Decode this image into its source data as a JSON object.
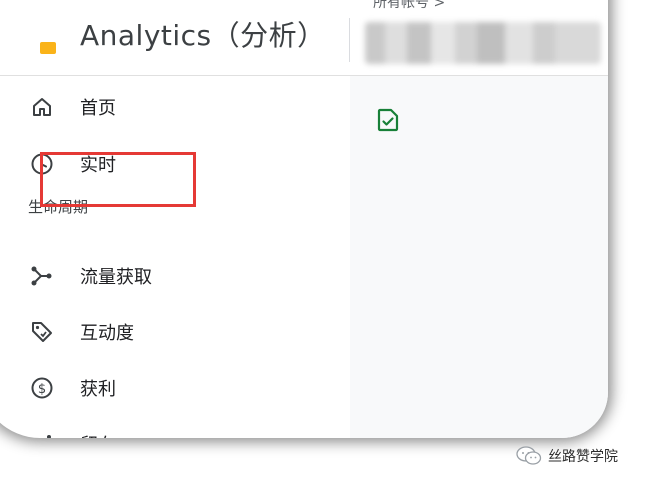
{
  "header": {
    "app_title": "Analytics（分析）",
    "account_label": "所有帐号 >",
    "account_name": ""
  },
  "nav": {
    "items": [
      {
        "label": "首页",
        "icon": "home-icon"
      },
      {
        "label": "实时",
        "icon": "clock-icon"
      }
    ],
    "section": "生命周期",
    "lifecycle_items": [
      {
        "label": "流量获取",
        "icon": "acquisition-icon"
      },
      {
        "label": "互动度",
        "icon": "engagement-tag-icon"
      },
      {
        "label": "获利",
        "icon": "dollar-circle-icon"
      },
      {
        "label": "留存",
        "icon": "retention-icon"
      }
    ]
  },
  "watermark": {
    "text": "丝路赞学院",
    "icon": "wechat-icon"
  },
  "colors": {
    "highlight": "#e53935",
    "page_icon": "#188038",
    "accent": "#f9ab00"
  }
}
